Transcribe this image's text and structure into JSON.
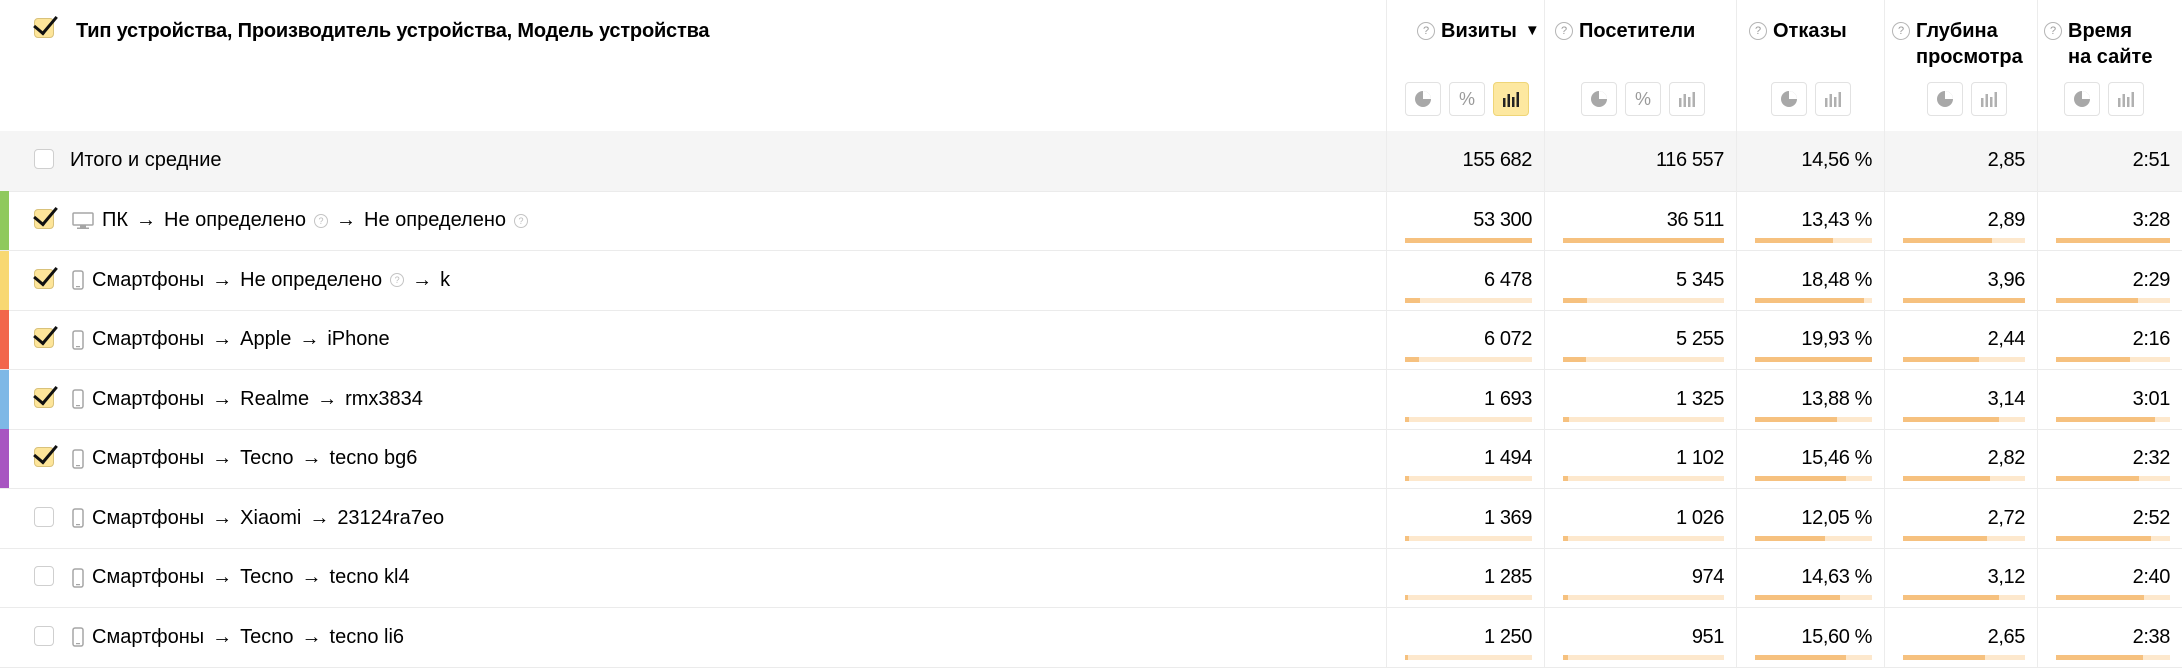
{
  "header": {
    "group_title": "Тип устройства, Производитель устройства, Модель устройства",
    "checked": true,
    "metrics": [
      {
        "label": "Визиты",
        "sorted": true,
        "sort_arrow": "▼",
        "buttons": [
          "pie",
          "percent",
          "bars"
        ],
        "active": "bars"
      },
      {
        "label": "Посетители",
        "buttons": [
          "pie",
          "percent",
          "bars"
        ],
        "active": ""
      },
      {
        "label": "Отказы",
        "buttons": [
          "pie",
          "bars"
        ],
        "active": ""
      },
      {
        "label": "Глубина просмотра",
        "label_line1": "Глубина",
        "label_line2": "просмотра",
        "buttons": [
          "pie",
          "bars"
        ],
        "active": ""
      },
      {
        "label": "Время на сайте",
        "label_line1": "Время",
        "label_line2": "на сайте",
        "buttons": [
          "pie",
          "bars"
        ],
        "active": ""
      }
    ]
  },
  "total": {
    "label": "Итого и средние",
    "values": [
      "155 682",
      "116 557",
      "14,56 %",
      "2,85",
      "2:51"
    ]
  },
  "rows": [
    {
      "checked": true,
      "stripe": "#8fc95d",
      "device_icon": "monitor-icon",
      "device": "ПК",
      "manufacturer": "Не определено",
      "manufacturer_hint": true,
      "model": "Не определено",
      "model_hint": true,
      "visits": "53 300",
      "visitors": "36 511",
      "bounce": "13,43 %",
      "depth": "2,89",
      "time": "3:28",
      "bars": [
        1.0,
        1.0,
        0.67,
        0.73,
        1.0
      ]
    },
    {
      "checked": true,
      "stripe": "#f8d872",
      "device_icon": "phone-icon",
      "device": "Смартфоны",
      "manufacturer": "Не определено",
      "manufacturer_hint": true,
      "model": "k",
      "model_hint": false,
      "visits": "6 478",
      "visitors": "5 345",
      "bounce": "18,48 %",
      "depth": "3,96",
      "time": "2:29",
      "bars": [
        0.12,
        0.15,
        0.93,
        1.0,
        0.72
      ]
    },
    {
      "checked": true,
      "stripe": "#f2664b",
      "device_icon": "phone-icon",
      "device": "Смартфоны",
      "manufacturer": "Apple",
      "manufacturer_hint": false,
      "model": "iPhone",
      "model_hint": false,
      "visits": "6 072",
      "visitors": "5 255",
      "bounce": "19,93 %",
      "depth": "2,44",
      "time": "2:16",
      "bars": [
        0.11,
        0.14,
        1.0,
        0.62,
        0.65
      ]
    },
    {
      "checked": true,
      "stripe": "#7eb8e6",
      "device_icon": "phone-icon",
      "device": "Смартфоны",
      "manufacturer": "Realme",
      "manufacturer_hint": false,
      "model": "rmx3834",
      "model_hint": false,
      "visits": "1 693",
      "visitors": "1 325",
      "bounce": "13,88 %",
      "depth": "3,14",
      "time": "3:01",
      "bars": [
        0.03,
        0.04,
        0.7,
        0.79,
        0.87
      ]
    },
    {
      "checked": true,
      "stripe": "#a855c1",
      "device_icon": "phone-icon",
      "device": "Смартфоны",
      "manufacturer": "Tecno",
      "manufacturer_hint": false,
      "model": "tecno bg6",
      "model_hint": false,
      "visits": "1 494",
      "visitors": "1 102",
      "bounce": "15,46 %",
      "depth": "2,82",
      "time": "2:32",
      "bars": [
        0.03,
        0.03,
        0.78,
        0.71,
        0.73
      ]
    },
    {
      "checked": false,
      "stripe": "",
      "device_icon": "phone-icon",
      "device": "Смартфоны",
      "manufacturer": "Xiaomi",
      "manufacturer_hint": false,
      "model": "23124ra7eo",
      "model_hint": false,
      "visits": "1 369",
      "visitors": "1 026",
      "bounce": "12,05 %",
      "depth": "2,72",
      "time": "2:52",
      "bars": [
        0.03,
        0.03,
        0.6,
        0.69,
        0.83
      ]
    },
    {
      "checked": false,
      "stripe": "",
      "device_icon": "phone-icon",
      "device": "Смартфоны",
      "manufacturer": "Tecno",
      "manufacturer_hint": false,
      "model": "tecno kl4",
      "model_hint": false,
      "visits": "1 285",
      "visitors": "974",
      "bounce": "14,63 %",
      "depth": "3,12",
      "time": "2:40",
      "bars": [
        0.02,
        0.03,
        0.73,
        0.79,
        0.77
      ]
    },
    {
      "checked": false,
      "stripe": "",
      "device_icon": "phone-icon",
      "device": "Смартфоны",
      "manufacturer": "Tecno",
      "manufacturer_hint": false,
      "model": "tecno li6",
      "model_hint": false,
      "visits": "1 250",
      "visitors": "951",
      "bounce": "15,60 %",
      "depth": "2,65",
      "time": "2:38",
      "bars": [
        0.02,
        0.03,
        0.78,
        0.67,
        0.76
      ]
    }
  ]
}
